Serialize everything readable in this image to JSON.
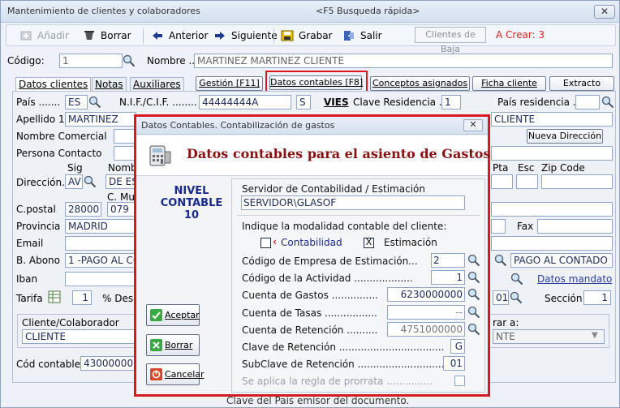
{
  "window": {
    "title": "Mantenimiento de clientes y colaboradores",
    "hint": "<F5 Busqueda rápida>"
  },
  "toolbar": {
    "anadir": "Añadir",
    "borrar": "Borrar",
    "anterior": "Anterior",
    "siguiente": "Siguiente",
    "grabar": "Grabar",
    "salir": "Salir",
    "clientes_baja": "Clientes de Baja",
    "a_crear": "A Crear: 3"
  },
  "codigo": {
    "label": "Código:",
    "value": "1"
  },
  "nombre": {
    "label": "Nombre ..",
    "value": "MARTINEZ MARTINEZ CLIENTE"
  },
  "tabs": [
    "Datos clientes",
    "Notas",
    "Auxiliares"
  ],
  "subtabs": [
    "Gestión [F11]",
    "Datos contables [F8]",
    "Conceptos asignados",
    "Ficha cliente",
    "Extracto"
  ],
  "form": {
    "pais_label": "País .......",
    "pais_value": "ES",
    "nif_label": "N.I.F./C.I.F. ........",
    "nif_value": "44444444A",
    "s_value": "S",
    "vies": "VIES",
    "clave_res_label": "Clave Residencia ..",
    "clave_res_value": "1",
    "pais_res_label": "País residencia ..",
    "apellido1_label": "Apellido 1",
    "apellido1_value": "MARTINEZ",
    "cliente_tail": "CLIENTE",
    "nombre_comercial_label": "Nombre Comercial",
    "nueva_direccion": "Nueva Dirección",
    "persona_contacto_label": "Persona Contacto",
    "sig_label": "Sig",
    "nomb_label": "Nomb",
    "pta_label": "Pta",
    "esc_label": "Esc",
    "zip_label": "Zip Code",
    "direccion_label": "Dirección.",
    "sig_value": "AV",
    "dir_value": "DE ES",
    "cmu_label": "C. Mu",
    "cpostal_label": "C.postal",
    "cpostal_value": "28000",
    "cmu_value": "079",
    "provincia_label": "Provincia",
    "provincia_value": "MADRID",
    "fax_label": "Fax",
    "email_label": "Email",
    "babono_label": "B. Abono",
    "babono_value": "1 -PAGO AL CO",
    "pago_value": "PAGO AL CONTADO",
    "iban_label": "Iban",
    "datos_mandato": "Datos mandato",
    "tarifa_label": "Tarifa",
    "tarifa_value": "1",
    "desc_label": "% Desc",
    "n01": "01",
    "seccion_label": "Sección",
    "seccion_value": "1",
    "cliente_colab_label": "Cliente/Colaborador",
    "cliente_colab_value": "CLIENTE",
    "rar_label": "rar a:",
    "rar_value": "NTE",
    "cod_contable_label": "Cód contable",
    "cod_contable_value": "430000000",
    "status_text": "Clave del País emisor del documento."
  },
  "dialog": {
    "title": "Datos Contables. Contabilización de gastos",
    "heading": "Datos contables para el asiento de Gastos",
    "nivel": [
      "NIVEL",
      "CONTABLE",
      "10"
    ],
    "buttons": {
      "aceptar": "Aceptar",
      "borrar": "Borrar",
      "cancelar": "Cancelar"
    },
    "servidor_label": "Servidor de Contabilidad / Estimación",
    "servidor_value": "SERVIDOR\\GLASOF",
    "modalidad_label": "Indique la modalidad contable del cliente:",
    "contabilidad_label": "Contabilidad",
    "estimacion_label": "Estimación",
    "estimacion_checked": "X",
    "rows": [
      {
        "label": "Código de Empresa de Estimación...",
        "value": "2"
      },
      {
        "label": "Código de la Actividad ...................",
        "value": "1"
      },
      {
        "label": "Cuenta de Gastos ...............",
        "value": "6230000000"
      },
      {
        "label": "Cuenta de Tasas .................",
        "value": "--"
      },
      {
        "label": "Cuenta de Retención ..........",
        "value": "4751000000"
      },
      {
        "label": "Clave de Retención ..................................",
        "value": "G"
      },
      {
        "label": "SubClave de Retención .............................",
        "value": "01"
      }
    ],
    "prorrata_label": "Se aplica la regla de prorrata ..............."
  },
  "colors": {
    "highlight": "#e0161d",
    "heading": "#8b1212",
    "nivel": "#1a2a8c",
    "a_crear": "#dd2222"
  }
}
